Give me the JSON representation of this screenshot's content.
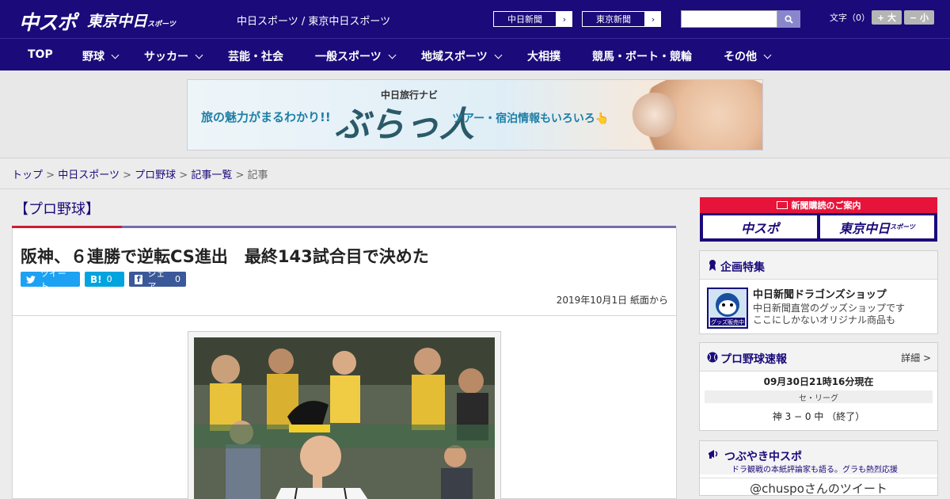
{
  "header": {
    "logo_chuspo": "中スポ",
    "logo_tokyo": "東京中日",
    "logo_tokyo_sub": "スポーツ",
    "site_title": "中日スポーツ / 東京中日スポーツ",
    "paper_links": [
      "中日新聞",
      "東京新聞"
    ],
    "search": {
      "placeholder": "",
      "icon": "search-icon"
    },
    "font_size_label": "文字（0）",
    "font_bigger": "+ 大",
    "font_smaller": "− 小"
  },
  "nav": {
    "items": [
      {
        "label": "TOP",
        "has_menu": false
      },
      {
        "label": "野球",
        "has_menu": true
      },
      {
        "label": "サッカー",
        "has_menu": true
      },
      {
        "label": "芸能・社会",
        "has_menu": false
      },
      {
        "label": "一般スポーツ",
        "has_menu": true
      },
      {
        "label": "地域スポーツ",
        "has_menu": true
      },
      {
        "label": "大相撲",
        "has_menu": false
      },
      {
        "label": "競馬・ボート・競輪",
        "has_menu": false
      },
      {
        "label": "その他",
        "has_menu": true
      }
    ]
  },
  "banner": {
    "tagline": "旅の魅力がまるわかり!!",
    "brand_small": "中日旅行ナビ",
    "brand_big": "ぶらっ人",
    "sub": "ツアー・宿泊情報もいろいろ👆"
  },
  "breadcrumb": {
    "items": [
      "トップ",
      "中日スポーツ",
      "プロ野球",
      "記事一覧"
    ],
    "current": "記事",
    "separator": ">"
  },
  "article": {
    "category": "【プロ野球】",
    "headline": "阪神、６連勝で逆転CS進出　最終143試合目で決めた",
    "share": {
      "tweet_label": "ツイート",
      "hatena_label": "B!",
      "hatena_count": "0",
      "facebook_label": "シェア",
      "facebook_count": "0"
    },
    "date": "2019年10月1日 紙面から"
  },
  "sidebar": {
    "subscribe": {
      "header": "新聞購読のご案内",
      "tiles": [
        "中スポ",
        "東京中日"
      ],
      "tile_sub": "スポーツ"
    },
    "feature": {
      "title": "企画特集",
      "shop_logo_text": "グッズ販売中",
      "shop_title": "中日新聞ドラゴンズショップ",
      "shop_desc_1": "中日新聞直営のグッズショップです",
      "shop_desc_2": "ここにしかないオリジナル商品も"
    },
    "scores": {
      "title": "プロ野球速報",
      "detail": "詳細 >",
      "time": "09月30日21時16分現在",
      "league": "セ・リーグ",
      "line": "神 3 − 0 中 （終了）"
    },
    "twitter": {
      "title": "つぶやき中スポ",
      "subtitle": "ドラ観戦の本紙評論家も語る。グラも熱烈応援",
      "link": "@chuspoさんのツイート"
    }
  },
  "colors": {
    "brand_navy": "#1a0a7a",
    "accent_red": "#d21b2f",
    "twitter": "#1da1f2",
    "hatena": "#00a4de",
    "facebook": "#3b5998"
  }
}
